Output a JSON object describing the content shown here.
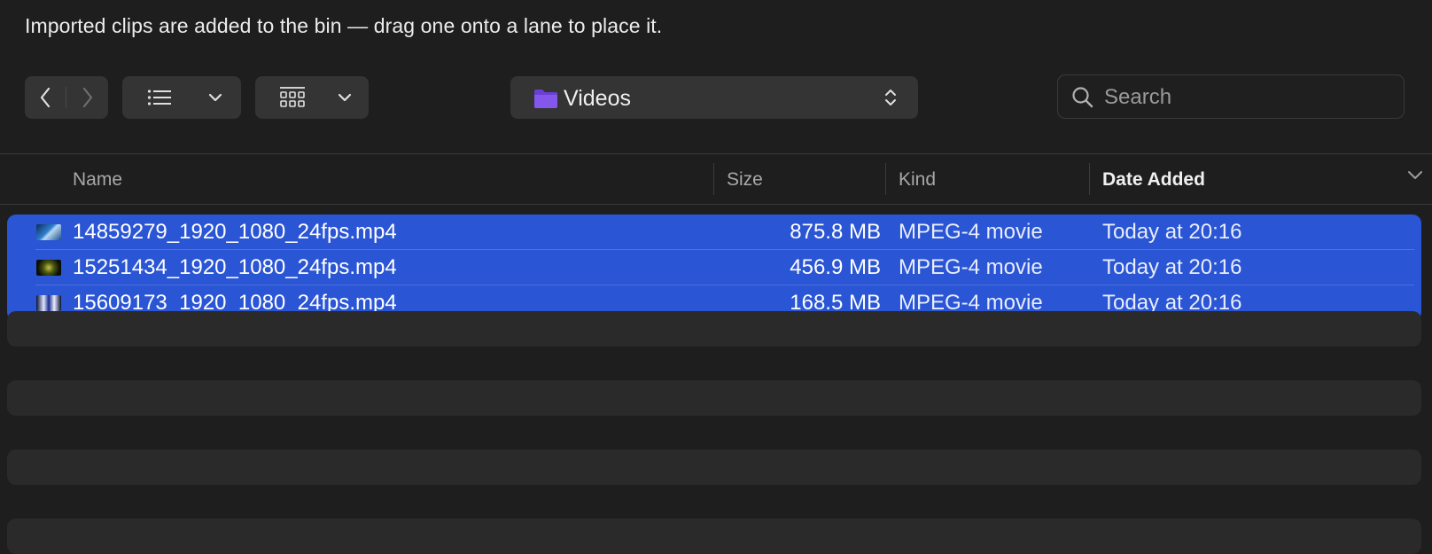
{
  "message": "Imported clips are added to the bin — drag one onto a lane to place it.",
  "toolbar": {
    "back_icon": "chevron-left-icon",
    "forward_icon": "chevron-right-icon",
    "list_view_icon": "list-icon",
    "grid_view_icon": "grid-icon",
    "folder_name": "Videos",
    "folder_icon_color": "#7b4fe0",
    "search_placeholder": "Search"
  },
  "columns": [
    {
      "label": "Name"
    },
    {
      "label": "Size"
    },
    {
      "label": "Kind"
    },
    {
      "label": "Date Added",
      "sorted": true
    }
  ],
  "files": [
    {
      "name": "14859279_1920_1080_24fps.mp4",
      "size": "875.8 MB",
      "kind": "MPEG-4 movie",
      "date_added": "Today at 20:16",
      "selected": true
    },
    {
      "name": "15251434_1920_1080_24fps.mp4",
      "size": "456.9 MB",
      "kind": "MPEG-4 movie",
      "date_added": "Today at 20:16",
      "selected": true
    },
    {
      "name": "15609173_1920_1080_24fps.mp4",
      "size": "168.5 MB",
      "kind": "MPEG-4 movie",
      "date_added": "Today at 20:16",
      "selected": true
    }
  ],
  "colors": {
    "selection": "#2a55d4",
    "background": "#1e1e1e"
  }
}
